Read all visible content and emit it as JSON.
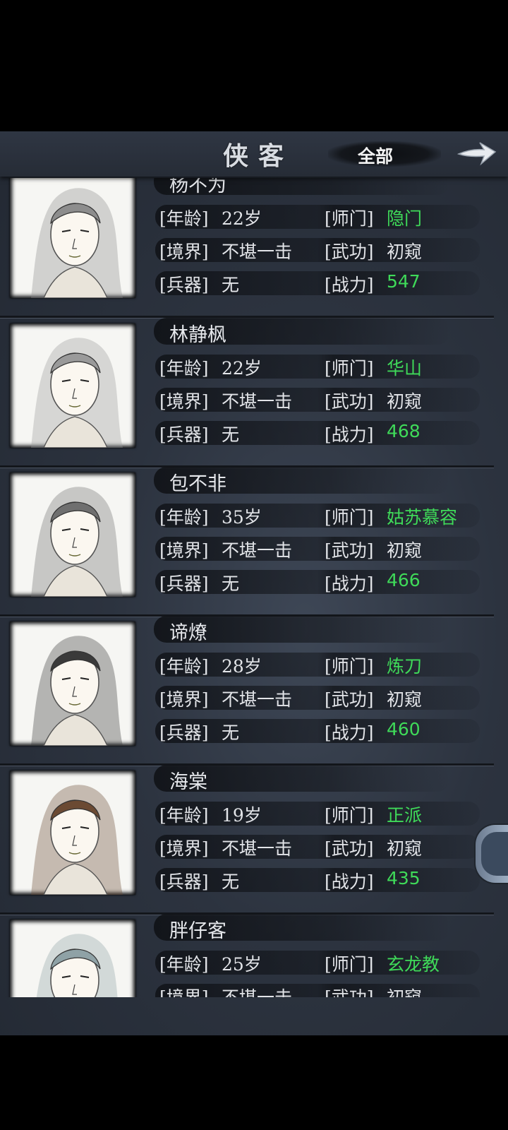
{
  "header": {
    "title": "侠客",
    "filter_label": "全部",
    "next_icon": "arrow-right-icon"
  },
  "labels": {
    "age": "[年龄]",
    "realm": "[境界]",
    "weapon": "[兵器]",
    "sect": "[师门]",
    "martial": "[武功]",
    "power": "[战力]"
  },
  "heroes": [
    {
      "name": "杨不为",
      "age": "22岁",
      "realm": "不堪一击",
      "weapon": "无",
      "sect": "隐门",
      "martial": "初窥",
      "power": "547"
    },
    {
      "name": "林静枫",
      "age": "22岁",
      "realm": "不堪一击",
      "weapon": "无",
      "sect": "华山",
      "martial": "初窥",
      "power": "468"
    },
    {
      "name": "包不非",
      "age": "35岁",
      "realm": "不堪一击",
      "weapon": "无",
      "sect": "姑苏慕容",
      "martial": "初窥",
      "power": "466"
    },
    {
      "name": "谛燎",
      "age": "28岁",
      "realm": "不堪一击",
      "weapon": "无",
      "sect": "炼刀",
      "martial": "初窥",
      "power": "460"
    },
    {
      "name": "海棠",
      "age": "19岁",
      "realm": "不堪一击",
      "weapon": "无",
      "sect": "正派",
      "martial": "初窥",
      "power": "435"
    },
    {
      "name": "胖仔客",
      "age": "25岁",
      "realm": "不堪一击",
      "weapon": "",
      "sect": "玄龙教",
      "martial": "初窥",
      "power": ""
    }
  ],
  "colors": {
    "value_green": "#3fda59",
    "panel": "#2c333f"
  }
}
